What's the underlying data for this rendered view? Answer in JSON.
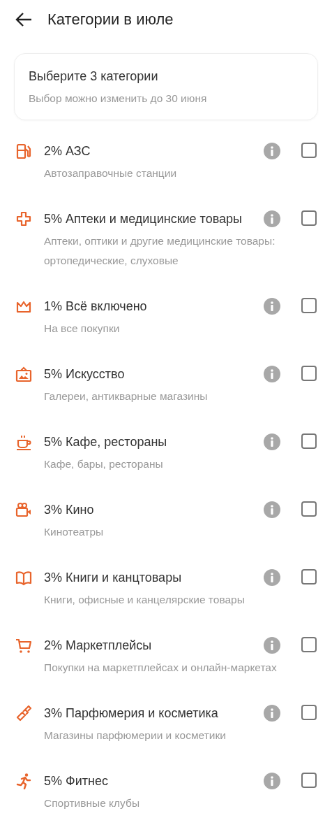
{
  "header": {
    "title": "Категории в июле"
  },
  "notice": {
    "title": "Выберите 3 категории",
    "subtitle": "Выбор можно изменить до 30 июня"
  },
  "categories": [
    {
      "title": "2% АЗС",
      "subtitle": "Автозаправочные станции",
      "checked": false
    },
    {
      "title": "5% Аптеки и медицинские товары",
      "subtitle": "Аптеки, оптики и другие медицинские товары: ортопедические, слуховые",
      "checked": false
    },
    {
      "title": "1% Всё включено",
      "subtitle": "На все покупки",
      "checked": false
    },
    {
      "title": "5% Искусство",
      "subtitle": "Галереи, антикварные магазины",
      "checked": false
    },
    {
      "title": "5% Кафе, рестораны",
      "subtitle": "Кафе, бары, рестораны",
      "checked": false
    },
    {
      "title": "3% Кино",
      "subtitle": "Кинотеатры",
      "checked": false
    },
    {
      "title": "3% Книги и канцтовары",
      "subtitle": "Книги, офисные и канцелярские товары",
      "checked": false
    },
    {
      "title": "2% Маркетплейсы",
      "subtitle": "Покупки на маркетплейсах и онлайн-маркетах",
      "checked": false
    },
    {
      "title": "3% Парфюмерия и косметика",
      "subtitle": "Магазины парфюмерии и косметики",
      "checked": false
    },
    {
      "title": "5% Фитнес",
      "subtitle": "Спортивные клубы",
      "checked": false
    }
  ]
}
